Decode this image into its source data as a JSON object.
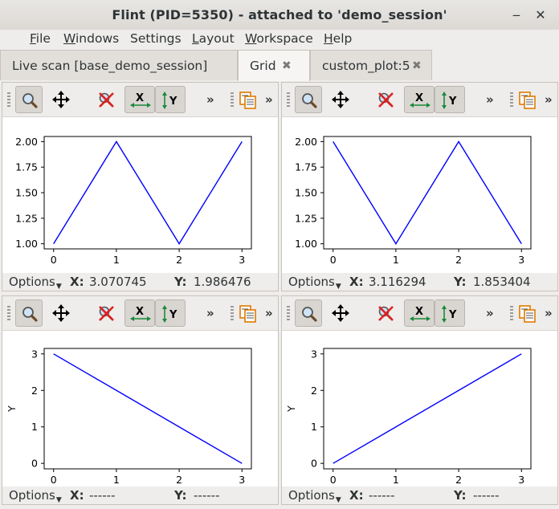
{
  "window": {
    "title": "Flint (PID=5350) - attached to 'demo_session'",
    "minimize_glyph": "‒",
    "close_glyph": "✕"
  },
  "menubar": {
    "items": [
      {
        "label": "File",
        "mnemonic": "F",
        "rest": "ile"
      },
      {
        "label": "Windows",
        "mnemonic": "W",
        "rest": "indows"
      },
      {
        "label": "Settings",
        "mnemonic": "",
        "rest": "Settings"
      },
      {
        "label": "Layout",
        "mnemonic": "L",
        "rest": "ayout"
      },
      {
        "label": "Workspace",
        "mnemonic": "W",
        "rest": "orkspace"
      },
      {
        "label": "Help",
        "mnemonic": "H",
        "rest": "elp"
      }
    ]
  },
  "tabs": [
    {
      "label": "Live scan [base_demo_session]",
      "active": false,
      "closable": false
    },
    {
      "label": "Grid",
      "active": true,
      "closable": true
    },
    {
      "label": "custom_plot:5",
      "active": false,
      "closable": true
    }
  ],
  "toolbar": {
    "icons": [
      "zoom-icon",
      "pan-icon",
      "reset-zoom-icon",
      "x-axis-autoscale-icon",
      "y-axis-autoscale-icon",
      "more-icon",
      "copy-icon",
      "more-icon"
    ],
    "more_glyph": "»"
  },
  "colors": {
    "line": "#0000ff",
    "status_bg": "#efedeb"
  },
  "panels": [
    {
      "status": {
        "options": "Options",
        "x_label": "X:",
        "x_value": "3.070745",
        "y_label": "Y:",
        "y_value": "1.986476"
      }
    },
    {
      "status": {
        "options": "Options",
        "x_label": "X:",
        "x_value": "3.116294",
        "y_label": "Y:",
        "y_value": "1.853404"
      }
    },
    {
      "status": {
        "options": "Options",
        "x_label": "X:",
        "x_value": "------",
        "y_label": "Y:",
        "y_value": "------"
      }
    },
    {
      "status": {
        "options": "Options",
        "x_label": "X:",
        "x_value": "------",
        "y_label": "Y:",
        "y_value": "------"
      }
    }
  ],
  "chart_data": [
    {
      "type": "line",
      "x": [
        0,
        1,
        2,
        3
      ],
      "series": [
        {
          "values": [
            1.0,
            2.0,
            1.0,
            2.0
          ]
        }
      ],
      "xticks": [
        "0",
        "1",
        "2",
        "3"
      ],
      "yticks": [
        "1.00",
        "1.25",
        "1.50",
        "1.75",
        "2.00"
      ],
      "xlim": [
        -0.15,
        3.15
      ],
      "ylim": [
        0.95,
        2.05
      ],
      "xlabel": "",
      "ylabel": "",
      "grid": false
    },
    {
      "type": "line",
      "x": [
        0,
        1,
        2,
        3
      ],
      "series": [
        {
          "values": [
            2.0,
            1.0,
            2.0,
            1.0
          ]
        }
      ],
      "xticks": [
        "0",
        "1",
        "2",
        "3"
      ],
      "yticks": [
        "1.00",
        "1.25",
        "1.50",
        "1.75",
        "2.00"
      ],
      "xlim": [
        -0.15,
        3.15
      ],
      "ylim": [
        0.95,
        2.05
      ],
      "xlabel": "",
      "ylabel": "",
      "grid": false
    },
    {
      "type": "line",
      "x": [
        0,
        1,
        2,
        3
      ],
      "series": [
        {
          "values": [
            3,
            2,
            1,
            0
          ]
        }
      ],
      "xticks": [
        "0",
        "1",
        "2",
        "3"
      ],
      "yticks": [
        "0",
        "1",
        "2",
        "3"
      ],
      "xlim": [
        -0.15,
        3.15
      ],
      "ylim": [
        -0.15,
        3.15
      ],
      "xlabel": "",
      "ylabel": "Y",
      "grid": false
    },
    {
      "type": "line",
      "x": [
        0,
        1,
        2,
        3
      ],
      "series": [
        {
          "values": [
            0,
            1,
            2,
            3
          ]
        }
      ],
      "xticks": [
        "0",
        "1",
        "2",
        "3"
      ],
      "yticks": [
        "0",
        "1",
        "2",
        "3"
      ],
      "xlim": [
        -0.15,
        3.15
      ],
      "ylim": [
        -0.15,
        3.15
      ],
      "xlabel": "",
      "ylabel": "Y",
      "grid": false
    }
  ]
}
